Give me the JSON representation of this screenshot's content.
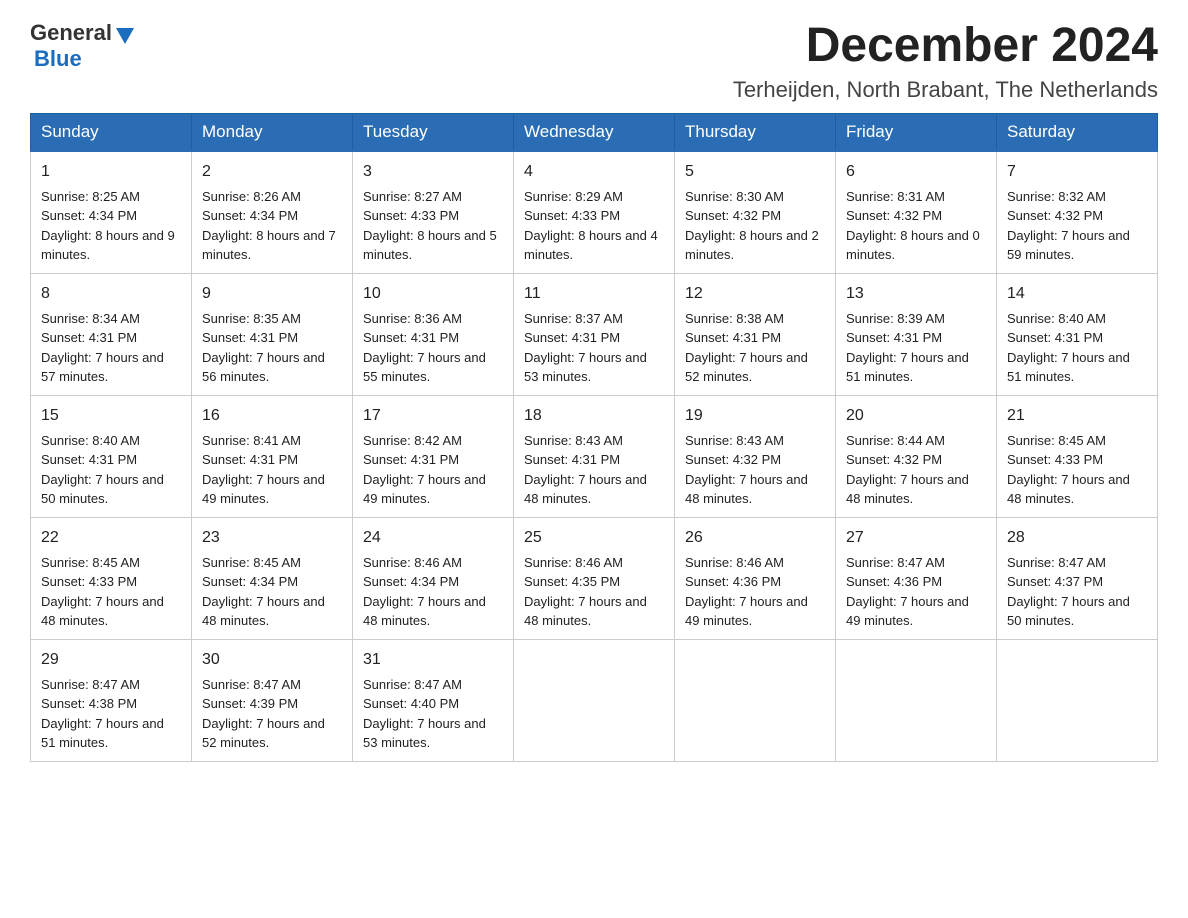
{
  "header": {
    "logo_general": "General",
    "logo_blue": "Blue",
    "month_year": "December 2024",
    "location": "Terheijden, North Brabant, The Netherlands"
  },
  "days_of_week": [
    "Sunday",
    "Monday",
    "Tuesday",
    "Wednesday",
    "Thursday",
    "Friday",
    "Saturday"
  ],
  "weeks": [
    [
      {
        "day": "1",
        "sunrise": "8:25 AM",
        "sunset": "4:34 PM",
        "daylight": "8 hours and 9 minutes."
      },
      {
        "day": "2",
        "sunrise": "8:26 AM",
        "sunset": "4:34 PM",
        "daylight": "8 hours and 7 minutes."
      },
      {
        "day": "3",
        "sunrise": "8:27 AM",
        "sunset": "4:33 PM",
        "daylight": "8 hours and 5 minutes."
      },
      {
        "day": "4",
        "sunrise": "8:29 AM",
        "sunset": "4:33 PM",
        "daylight": "8 hours and 4 minutes."
      },
      {
        "day": "5",
        "sunrise": "8:30 AM",
        "sunset": "4:32 PM",
        "daylight": "8 hours and 2 minutes."
      },
      {
        "day": "6",
        "sunrise": "8:31 AM",
        "sunset": "4:32 PM",
        "daylight": "8 hours and 0 minutes."
      },
      {
        "day": "7",
        "sunrise": "8:32 AM",
        "sunset": "4:32 PM",
        "daylight": "7 hours and 59 minutes."
      }
    ],
    [
      {
        "day": "8",
        "sunrise": "8:34 AM",
        "sunset": "4:31 PM",
        "daylight": "7 hours and 57 minutes."
      },
      {
        "day": "9",
        "sunrise": "8:35 AM",
        "sunset": "4:31 PM",
        "daylight": "7 hours and 56 minutes."
      },
      {
        "day": "10",
        "sunrise": "8:36 AM",
        "sunset": "4:31 PM",
        "daylight": "7 hours and 55 minutes."
      },
      {
        "day": "11",
        "sunrise": "8:37 AM",
        "sunset": "4:31 PM",
        "daylight": "7 hours and 53 minutes."
      },
      {
        "day": "12",
        "sunrise": "8:38 AM",
        "sunset": "4:31 PM",
        "daylight": "7 hours and 52 minutes."
      },
      {
        "day": "13",
        "sunrise": "8:39 AM",
        "sunset": "4:31 PM",
        "daylight": "7 hours and 51 minutes."
      },
      {
        "day": "14",
        "sunrise": "8:40 AM",
        "sunset": "4:31 PM",
        "daylight": "7 hours and 51 minutes."
      }
    ],
    [
      {
        "day": "15",
        "sunrise": "8:40 AM",
        "sunset": "4:31 PM",
        "daylight": "7 hours and 50 minutes."
      },
      {
        "day": "16",
        "sunrise": "8:41 AM",
        "sunset": "4:31 PM",
        "daylight": "7 hours and 49 minutes."
      },
      {
        "day": "17",
        "sunrise": "8:42 AM",
        "sunset": "4:31 PM",
        "daylight": "7 hours and 49 minutes."
      },
      {
        "day": "18",
        "sunrise": "8:43 AM",
        "sunset": "4:31 PM",
        "daylight": "7 hours and 48 minutes."
      },
      {
        "day": "19",
        "sunrise": "8:43 AM",
        "sunset": "4:32 PM",
        "daylight": "7 hours and 48 minutes."
      },
      {
        "day": "20",
        "sunrise": "8:44 AM",
        "sunset": "4:32 PM",
        "daylight": "7 hours and 48 minutes."
      },
      {
        "day": "21",
        "sunrise": "8:45 AM",
        "sunset": "4:33 PM",
        "daylight": "7 hours and 48 minutes."
      }
    ],
    [
      {
        "day": "22",
        "sunrise": "8:45 AM",
        "sunset": "4:33 PM",
        "daylight": "7 hours and 48 minutes."
      },
      {
        "day": "23",
        "sunrise": "8:45 AM",
        "sunset": "4:34 PM",
        "daylight": "7 hours and 48 minutes."
      },
      {
        "day": "24",
        "sunrise": "8:46 AM",
        "sunset": "4:34 PM",
        "daylight": "7 hours and 48 minutes."
      },
      {
        "day": "25",
        "sunrise": "8:46 AM",
        "sunset": "4:35 PM",
        "daylight": "7 hours and 48 minutes."
      },
      {
        "day": "26",
        "sunrise": "8:46 AM",
        "sunset": "4:36 PM",
        "daylight": "7 hours and 49 minutes."
      },
      {
        "day": "27",
        "sunrise": "8:47 AM",
        "sunset": "4:36 PM",
        "daylight": "7 hours and 49 minutes."
      },
      {
        "day": "28",
        "sunrise": "8:47 AM",
        "sunset": "4:37 PM",
        "daylight": "7 hours and 50 minutes."
      }
    ],
    [
      {
        "day": "29",
        "sunrise": "8:47 AM",
        "sunset": "4:38 PM",
        "daylight": "7 hours and 51 minutes."
      },
      {
        "day": "30",
        "sunrise": "8:47 AM",
        "sunset": "4:39 PM",
        "daylight": "7 hours and 52 minutes."
      },
      {
        "day": "31",
        "sunrise": "8:47 AM",
        "sunset": "4:40 PM",
        "daylight": "7 hours and 53 minutes."
      },
      null,
      null,
      null,
      null
    ]
  ]
}
